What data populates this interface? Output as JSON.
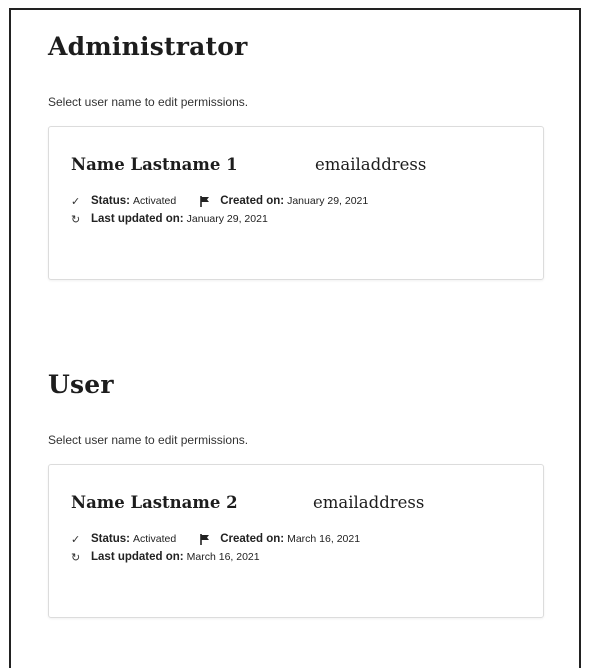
{
  "admin": {
    "title": "Administrator",
    "subtitle": "Select user name to edit permissions.",
    "card": {
      "name": "Name Lastname 1",
      "email": "emailaddress",
      "status_label": "Status:",
      "status_value": "Activated",
      "created_label": "Created on:",
      "created_value": "January 29, 2021",
      "updated_label": "Last updated on:",
      "updated_value": "January 29, 2021"
    }
  },
  "user": {
    "title": "User",
    "subtitle": "Select user name to edit permissions.",
    "card": {
      "name": "Name Lastname 2",
      "email": "emailaddress",
      "status_label": "Status:",
      "status_value": "Activated",
      "created_label": "Created on:",
      "created_value": "March 16, 2021",
      "updated_label": "Last updated on:",
      "updated_value": "March 16, 2021"
    }
  },
  "icons": {
    "status": "check-icon",
    "created": "flag-icon",
    "updated": "refresh-icon"
  }
}
